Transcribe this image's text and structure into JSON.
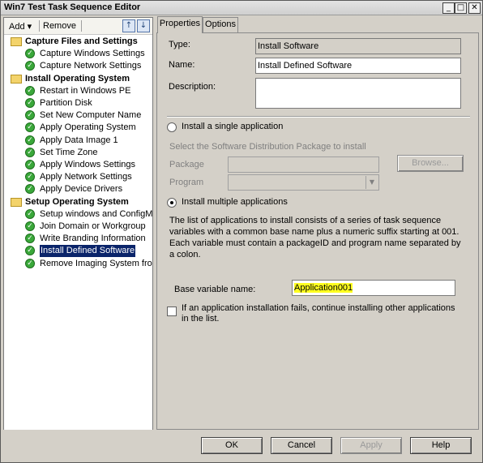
{
  "window": {
    "title": "Win7 Test Task Sequence Editor"
  },
  "toolbar": {
    "add_label": "Add",
    "remove_label": "Remove"
  },
  "tree": {
    "groups": [
      {
        "label": "Capture Files and Settings",
        "items": [
          "Capture Windows Settings",
          "Capture Network Settings"
        ]
      },
      {
        "label": "Install Operating System",
        "items": [
          "Restart in Windows PE",
          "Partition Disk",
          "Set New Computer Name",
          "Apply Operating System",
          "Apply Data Image 1",
          "Set Time Zone",
          "Apply Windows Settings",
          "Apply Network Settings",
          "Apply Device Drivers"
        ]
      },
      {
        "label": "Setup Operating System",
        "items": [
          "Setup windows and ConfigMgr",
          "Join Domain or Workgroup",
          "Write Branding Information",
          "Install Defined Software",
          "Remove Imaging System from G"
        ]
      }
    ],
    "selected": "Install Defined Software"
  },
  "tabs": [
    "Properties",
    "Options"
  ],
  "properties": {
    "type_label": "Type:",
    "type_value": "Install Software",
    "name_label": "Name:",
    "name_value": "Install Defined Software",
    "description_label": "Description:",
    "description_value": "",
    "single_app_label": "Install a single application",
    "single_app_selected": false,
    "package_prompt": "Select the Software Distribution Package to install",
    "package_label": "Package",
    "program_label": "Program",
    "browse_label": "Browse...",
    "multi_app_label": "Install multiple applications",
    "multi_app_selected": true,
    "multi_description": "The list of applications to install consists of a series of task sequence variables with a common base name plus a numeric suffix starting at 001.  Each variable must contain a packageID and program name separated by a colon.",
    "base_var_label": "Base variable name:",
    "base_var_value": "Application001",
    "continue_label": "If an application installation fails, continue installing other applications in the list.",
    "continue_checked": false
  },
  "buttons": {
    "ok": "OK",
    "cancel": "Cancel",
    "apply": "Apply",
    "help": "Help"
  },
  "colors": {
    "selection": "#0a246a",
    "highlight": "#ffff20",
    "check": "#3aa83a",
    "folder": "#f3d36b"
  }
}
